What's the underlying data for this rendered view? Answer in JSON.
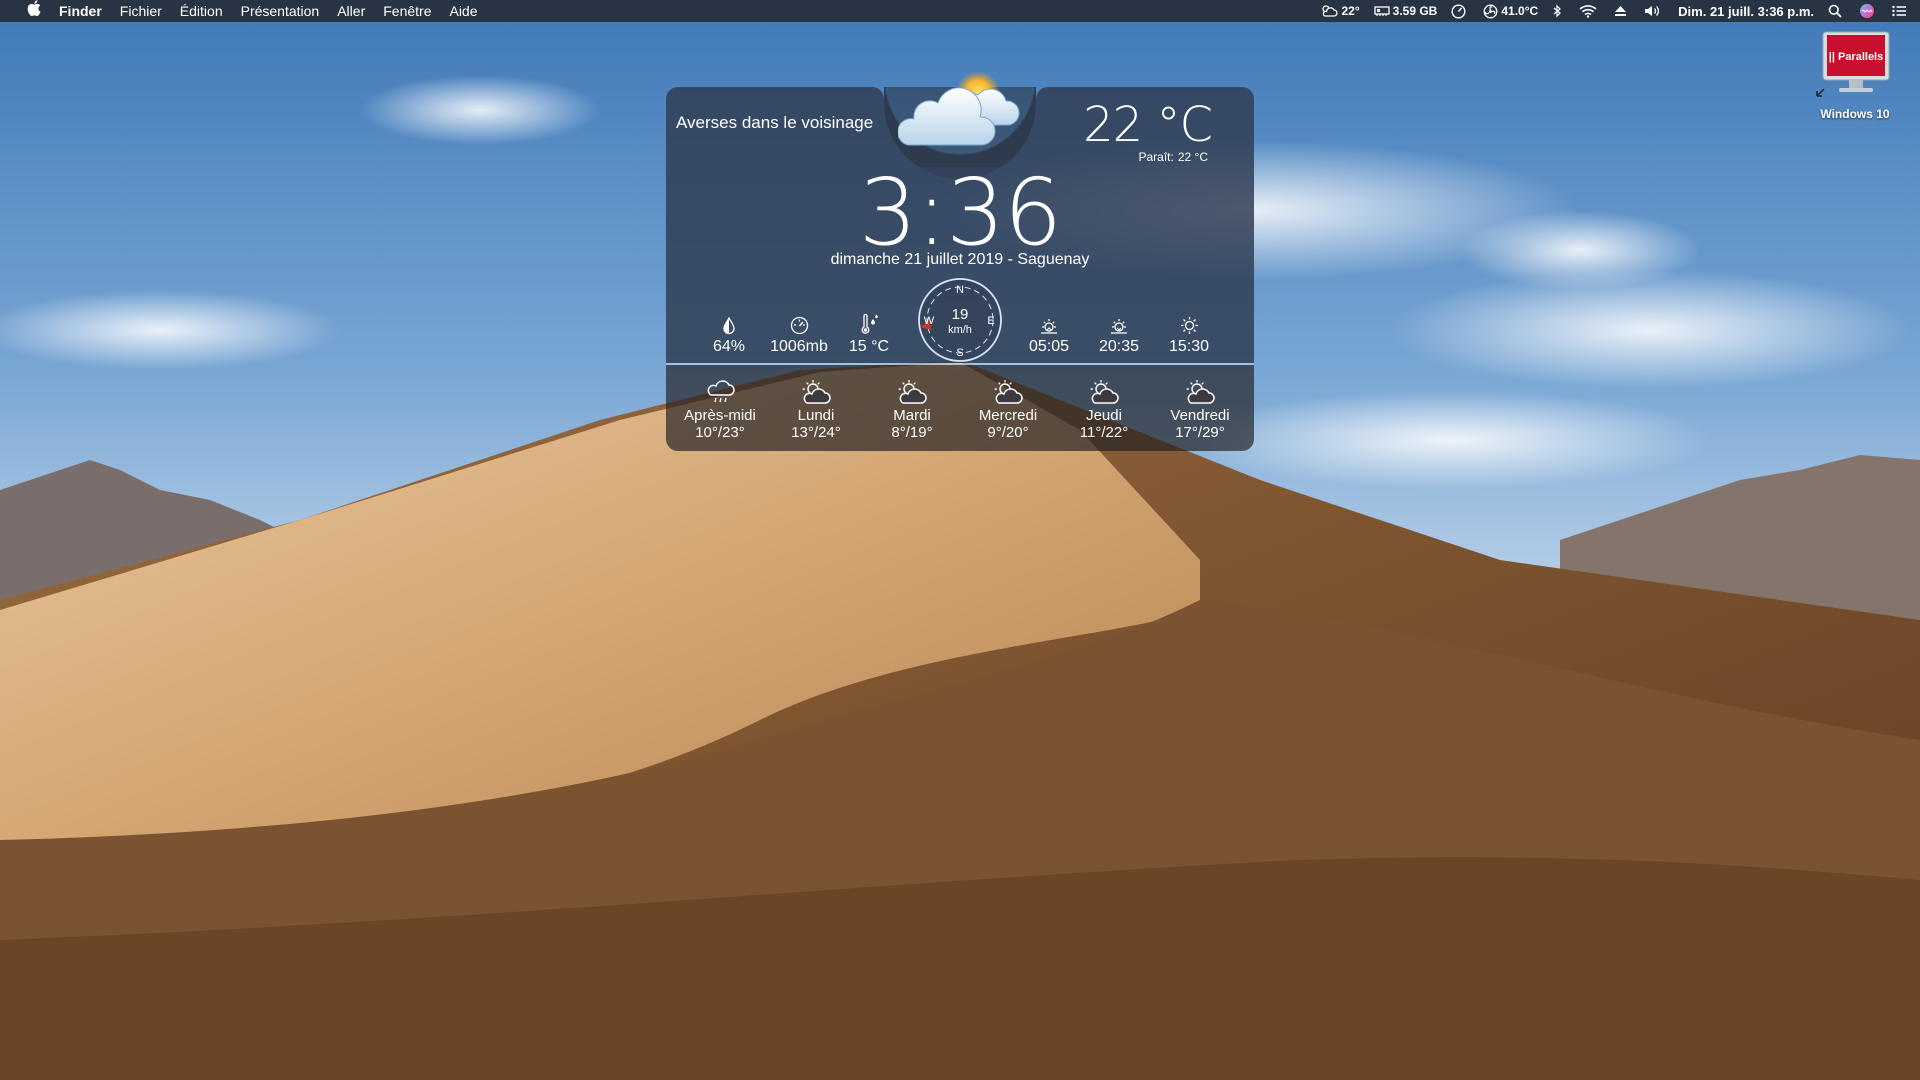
{
  "menubar": {
    "apple_icon": "apple-logo-icon",
    "items": [
      "Finder",
      "Fichier",
      "Édition",
      "Présentation",
      "Aller",
      "Fenêtre",
      "Aide"
    ],
    "status": {
      "weather_temp": "22°",
      "memory": "3.59 GB",
      "cpu_temp": "41.0°C",
      "datetime": "Dim. 21 juill.  3:36 p.m."
    }
  },
  "widget": {
    "condition": "Averses dans le voisinage",
    "temperature": "22 °C",
    "feels_label": "Paraît:",
    "feels_value": "22 °C",
    "time": "3:36",
    "date_location": "dimanche 21 juillet 2019 - Saguenay",
    "stats": {
      "humidity": "64%",
      "pressure": "1006mb",
      "dew_point": "15 °C",
      "sunrise": "05:05",
      "sunset": "20:35",
      "daylight": "15:30"
    },
    "wind": {
      "speed": "19",
      "unit": "km/h",
      "direction_deg": 260,
      "n": "N",
      "e": "E",
      "s": "S",
      "w": "W"
    },
    "forecast": [
      {
        "day": "Après-midi",
        "temps": "10°/23°",
        "icon": "rain-cloud-icon"
      },
      {
        "day": "Lundi",
        "temps": "13°/24°",
        "icon": "partly-cloudy-icon"
      },
      {
        "day": "Mardi",
        "temps": "8°/19°",
        "icon": "partly-cloudy-icon"
      },
      {
        "day": "Mercredi",
        "temps": "9°/20°",
        "icon": "partly-cloudy-icon"
      },
      {
        "day": "Jeudi",
        "temps": "11°/22°",
        "icon": "partly-cloudy-icon"
      },
      {
        "day": "Vendredi",
        "temps": "17°/29°",
        "icon": "partly-cloudy-icon"
      }
    ]
  },
  "desktop": {
    "icon_label": "Windows 10",
    "icon_badge": "|| Parallels"
  },
  "colors": {
    "menubar": "#262e3a",
    "widget_panel": "#303e55",
    "divider": "#aacdf0",
    "wind_arrow": "#c0392b",
    "parallels_red": "#c8102e"
  }
}
